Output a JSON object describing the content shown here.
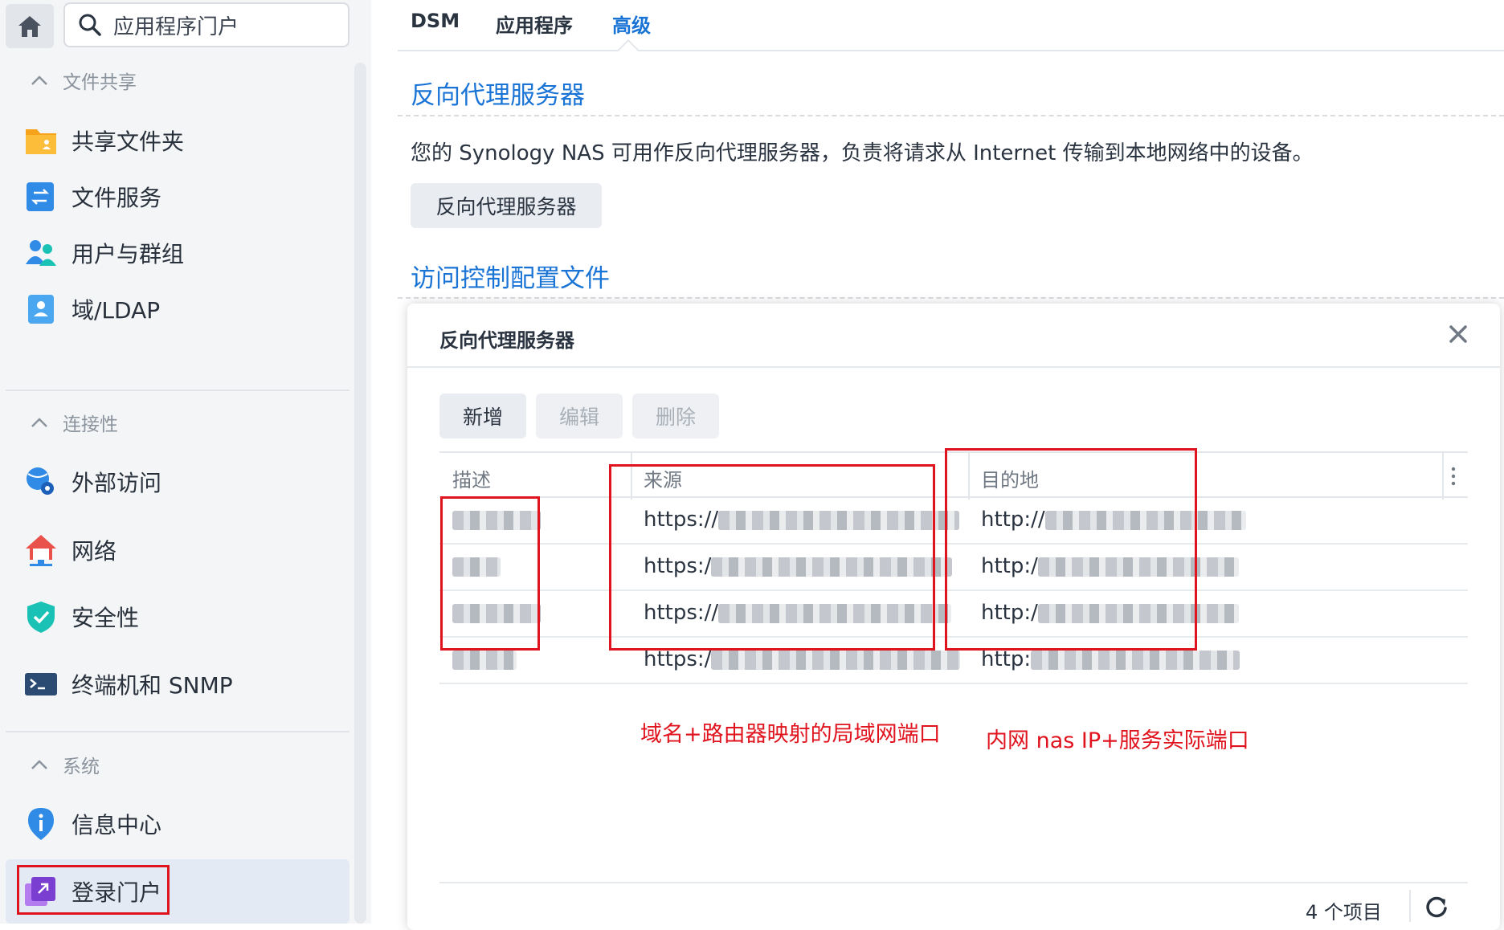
{
  "sidebar": {
    "search_placeholder": "应用程序门户",
    "sections": [
      {
        "label": "文件共享"
      },
      {
        "label": "连接性"
      },
      {
        "label": "系统"
      }
    ],
    "items": [
      {
        "label": "共享文件夹",
        "icon": "shared-folder-icon"
      },
      {
        "label": "文件服务",
        "icon": "file-services-icon"
      },
      {
        "label": "用户与群组",
        "icon": "users-groups-icon"
      },
      {
        "label": "域/LDAP",
        "icon": "domain-ldap-icon"
      },
      {
        "label": "外部访问",
        "icon": "external-access-icon"
      },
      {
        "label": "网络",
        "icon": "network-icon"
      },
      {
        "label": "安全性",
        "icon": "security-icon"
      },
      {
        "label": "终端机和 SNMP",
        "icon": "terminal-icon"
      },
      {
        "label": "信息中心",
        "icon": "info-center-icon"
      },
      {
        "label": "登录门户",
        "icon": "login-portal-icon",
        "active": true
      }
    ]
  },
  "tabs": [
    {
      "label": "DSM"
    },
    {
      "label": "应用程序"
    },
    {
      "label": "高级",
      "active": true
    }
  ],
  "main": {
    "reverse_proxy_heading": "反向代理服务器",
    "description": "您的 Synology NAS 可用作反向代理服务器，负责将请求从 Internet 传输到本地网络中的设备。",
    "reverse_proxy_button": "反向代理服务器",
    "access_control_heading": "访问控制配置文件"
  },
  "modal": {
    "title": "反向代理服务器",
    "buttons": {
      "add": "新增",
      "edit": "编辑",
      "delete": "删除"
    },
    "columns": {
      "description": "描述",
      "source": "来源",
      "destination": "目的地"
    },
    "rows": [
      {
        "source_prefix": "https://",
        "destination_prefix": "http://"
      },
      {
        "source_prefix": "https:/",
        "destination_prefix": "http:/"
      },
      {
        "source_prefix": "https://",
        "destination_prefix": "http:/"
      },
      {
        "source_prefix": "https:/",
        "destination_prefix": "http:"
      }
    ],
    "annotation_source": "域名+路由器映射的局域网端口",
    "annotation_destination": "内网 nas IP+服务实际端口",
    "item_count": "4 个项目"
  },
  "colors": {
    "accent": "#1a74d6",
    "annotation_red": "#e0141e",
    "sidebar_bg": "#f3f5f7"
  }
}
